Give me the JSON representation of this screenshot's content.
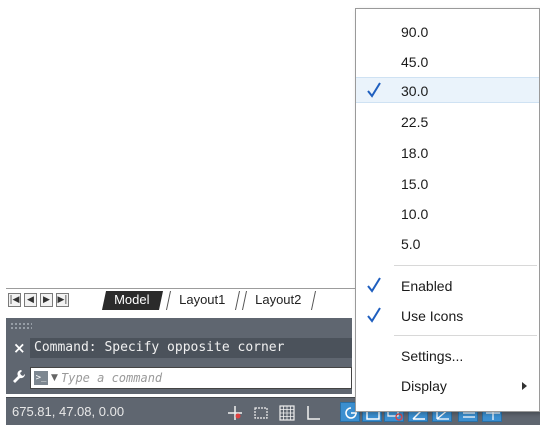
{
  "layout_tabs": {
    "nav": [
      "first-icon",
      "prev-icon",
      "next-icon",
      "last-icon"
    ],
    "tabs": [
      {
        "label": "Model",
        "active": true
      },
      {
        "label": "Layout1",
        "active": false
      },
      {
        "label": "Layout2",
        "active": false
      }
    ]
  },
  "command_line": {
    "history": "Command: Specify opposite corner",
    "prompt_glyph": ">_",
    "placeholder": "Type a command"
  },
  "status_bar": {
    "coordinates": "675.81, 47.08, 0.00",
    "active_color": "#3b8fd0"
  },
  "polar_menu": {
    "angles": [
      {
        "label": "90.0",
        "checked": false
      },
      {
        "label": "45.0",
        "checked": false
      },
      {
        "label": "30.0",
        "checked": true,
        "highlighted": true
      },
      {
        "label": "22.5",
        "checked": false
      },
      {
        "label": "18.0",
        "checked": false
      },
      {
        "label": "15.0",
        "checked": false
      },
      {
        "label": "10.0",
        "checked": false
      },
      {
        "label": "5.0",
        "checked": false
      }
    ],
    "enabled_label": "Enabled",
    "use_icons_label": "Use Icons",
    "settings_label": "Settings...",
    "display_label": "Display",
    "check_color": "#1f5fbf"
  }
}
